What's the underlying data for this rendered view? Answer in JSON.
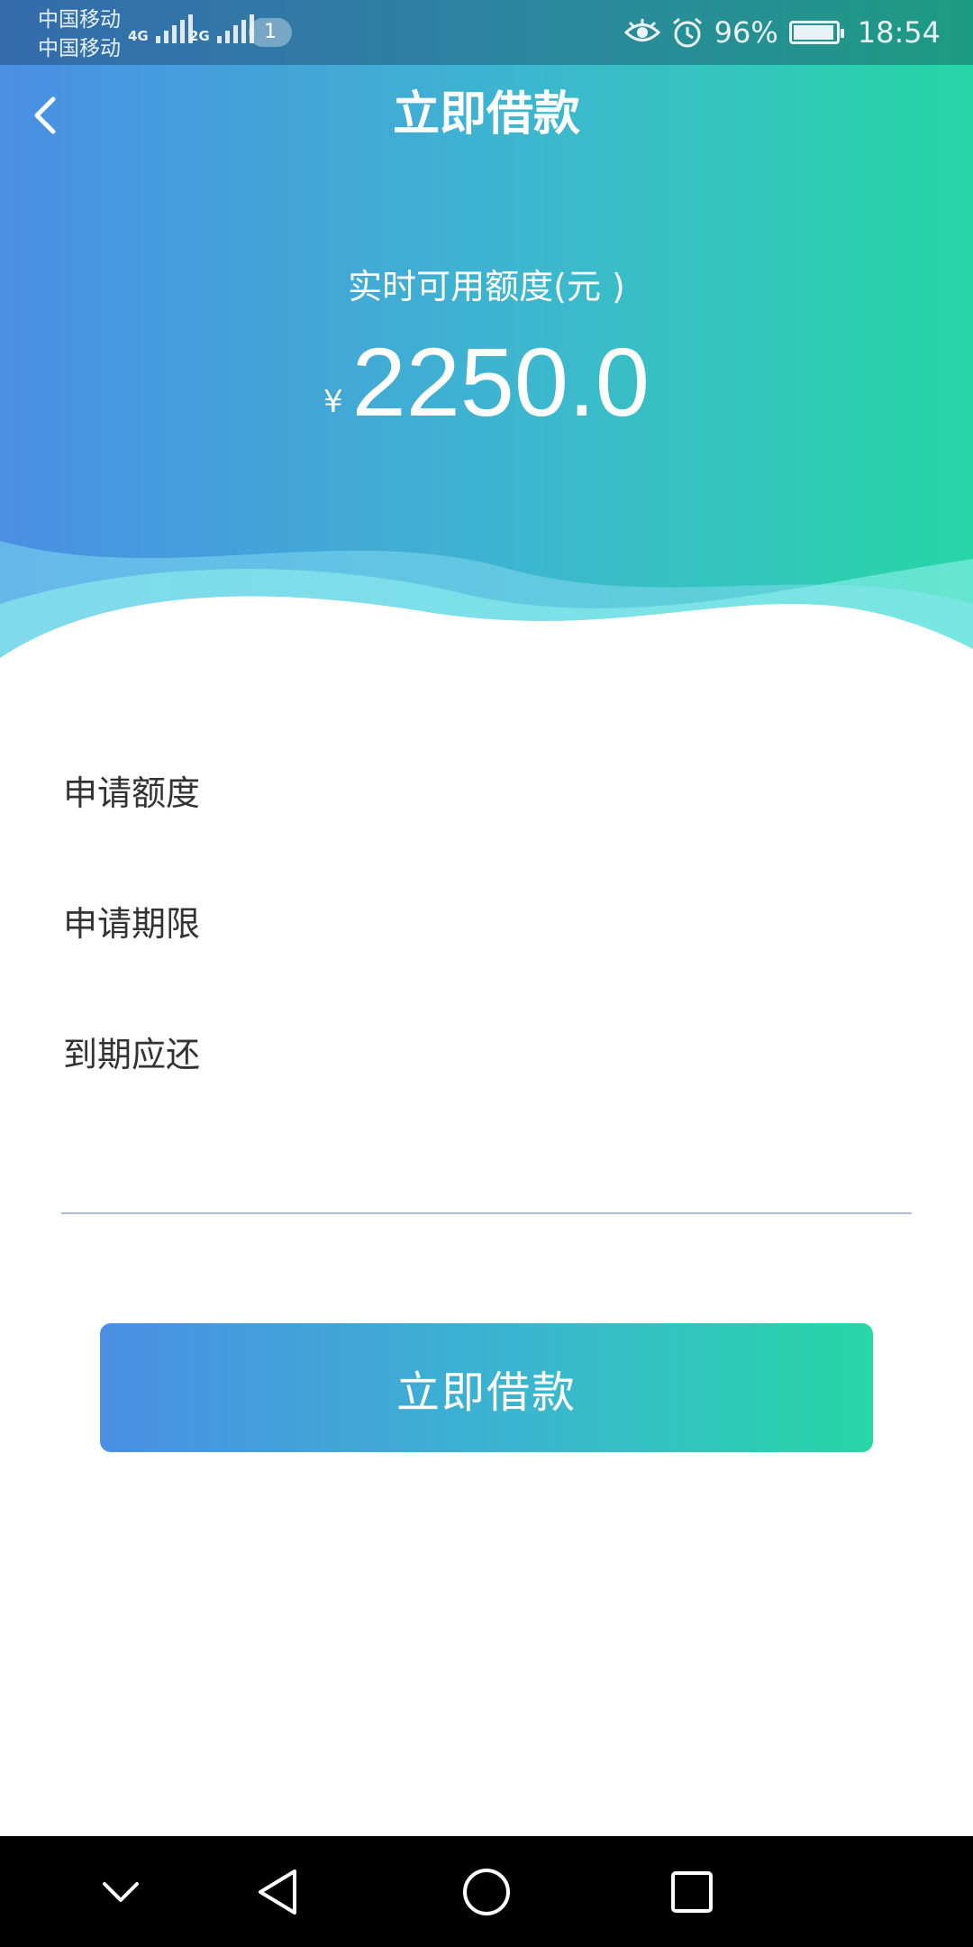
{
  "status_bar": {
    "carrier_1": "中国移动",
    "carrier_2": "中国移动",
    "network_1": "4G",
    "network_2": "2G",
    "sim_badge": "1",
    "battery_level": "96%",
    "battery_fill_fraction": 0.96,
    "time": "18:54"
  },
  "header": {
    "title": "立即借款",
    "quota_label": "实时可用额度(元 )",
    "currency_symbol": "¥",
    "available_amount": "2250.0"
  },
  "form": {
    "apply_amount_label": "申请额度",
    "apply_term_label": "申请期限",
    "due_repay_label": "到期应还"
  },
  "actions": {
    "submit_label": "立即借款"
  },
  "icons": {
    "back": "chevron-left-icon",
    "eye": "eye-icon",
    "alarm": "alarm-icon",
    "battery": "battery-icon",
    "nav_down": "chevron-down-icon",
    "nav_back": "triangle-back-icon",
    "nav_home": "circle-home-icon",
    "nav_recent": "square-recent-icon"
  },
  "colors": {
    "gradient_start": "#4a8fe3",
    "gradient_end": "#27d6a6",
    "text_primary": "#333333"
  }
}
